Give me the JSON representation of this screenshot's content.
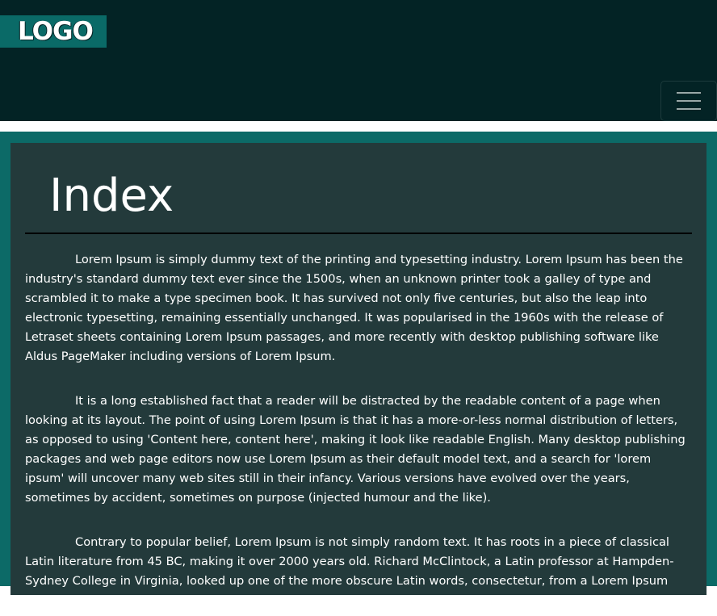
{
  "header": {
    "logo_text": "LOGO",
    "menu_toggle_label": "Toggle navigation"
  },
  "main": {
    "title": "Index",
    "paragraphs": [
      "Lorem Ipsum is simply dummy text of the printing and typesetting industry. Lorem Ipsum has been the industry's standard dummy text ever since the 1500s, when an unknown printer took a galley of type and scrambled it to make a type specimen book. It has survived not only five centuries, but also the leap into electronic typesetting, remaining essentially unchanged. It was popularised in the 1960s with the release of Letraset sheets containing Lorem Ipsum passages, and more recently with desktop publishing software like Aldus PageMaker including versions of Lorem Ipsum.",
      "It is a long established fact that a reader will be distracted by the readable content of a page when looking at its layout. The point of using Lorem Ipsum is that it has a more-or-less normal distribution of letters, as opposed to using 'Content here, content here', making it look like readable English. Many desktop publishing packages and web page editors now use Lorem Ipsum as their default model text, and a search for 'lorem ipsum' will uncover many web sites still in their infancy. Various versions have evolved over the years, sometimes by accident, sometimes on purpose (injected humour and the like).",
      "Contrary to popular belief, Lorem Ipsum is not simply random text. It has roots in a piece of classical Latin literature from 45 BC, making it over 2000 years old. Richard McClintock, a Latin professor at Hampden-Sydney College in Virginia, looked up one of the more obscure Latin words, consectetur, from a Lorem Ipsum"
    ]
  },
  "colors": {
    "navbar_bg": "#032325",
    "logo_bg": "#0a6a67",
    "wrapper_bg": "#0c6a67",
    "panel_bg": "#233a3b",
    "text": "#ffffff"
  },
  "icons": {
    "menu": "hamburger-icon"
  }
}
